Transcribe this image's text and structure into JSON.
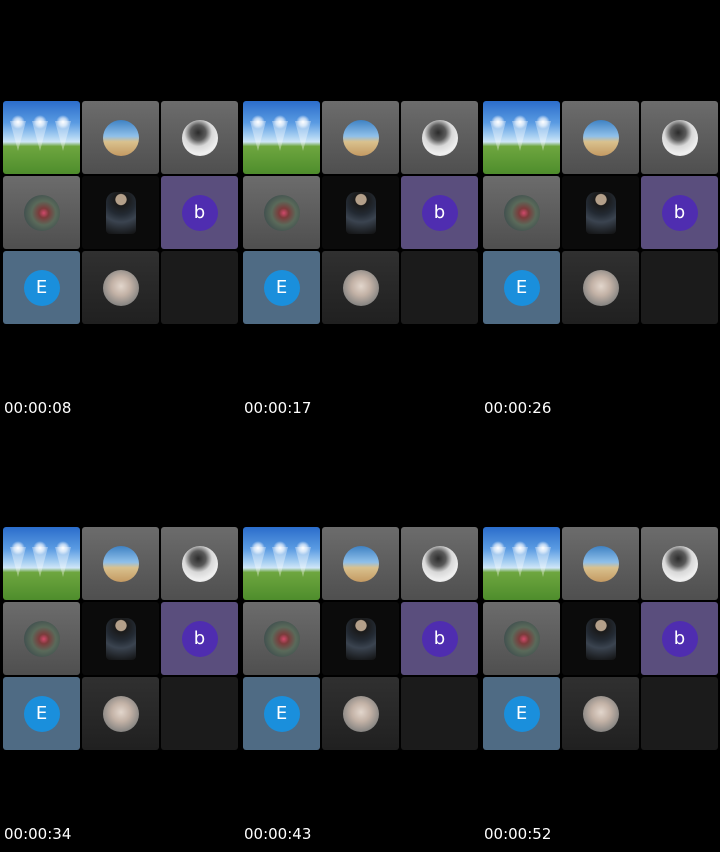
{
  "colors": {
    "background": "#000000",
    "letter_b_circle": "#4f2db0",
    "letter_e_circle": "#1a8fdc",
    "purple_tile": "#5a4e7d",
    "steel_tile": "#4f6b84"
  },
  "tiles": {
    "avatar_b_letter": "b",
    "avatar_e_letter": "E"
  },
  "frames": [
    {
      "timestamp": "00:00:08"
    },
    {
      "timestamp": "00:00:17"
    },
    {
      "timestamp": "00:00:26"
    },
    {
      "timestamp": "00:00:34"
    },
    {
      "timestamp": "00:00:43"
    },
    {
      "timestamp": "00:00:52"
    }
  ]
}
